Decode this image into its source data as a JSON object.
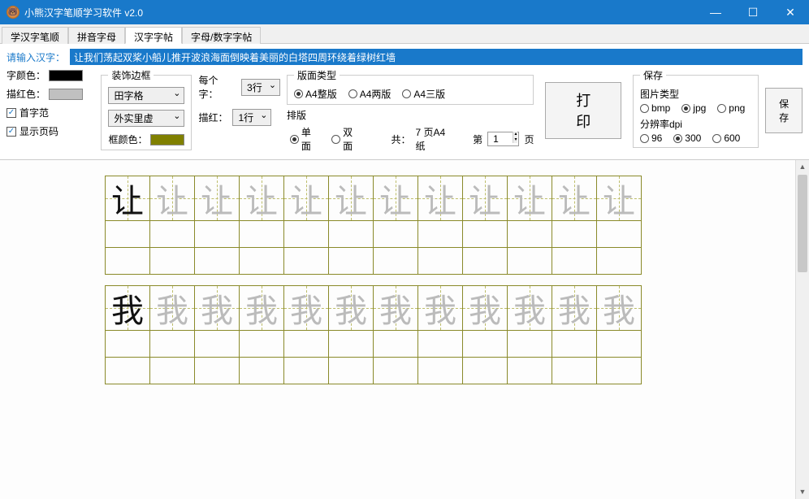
{
  "window": {
    "title": "小熊汉字笔顺学习软件 v2.0"
  },
  "tabs": [
    "学汉字笔顺",
    "拼音字母",
    "汉字字帖",
    "字母/数字字帖"
  ],
  "active_tab": 2,
  "input": {
    "label": "请输入汉字：",
    "value": "让我们荡起双桨小船儿推开波浪海面倒映着美丽的白塔四周环绕着绿树红墙"
  },
  "color": {
    "font_label": "字颜色：",
    "font": "#000000",
    "trace_label": "描红色：",
    "trace": "#c0c0c0"
  },
  "opts": {
    "first_model": "首字范",
    "show_page": "显示页码"
  },
  "border": {
    "legend": "装饰边框",
    "grid_style": "田字格",
    "line_style": "外实里虚",
    "frame_label": "框颜色：",
    "frame_color": "#808000"
  },
  "perchar": {
    "label": "每个字：",
    "rows_val": "3行",
    "trace_label": "描红：",
    "trace_val": "1行"
  },
  "layout": {
    "type_legend": "版面类型",
    "types": [
      "A4整版",
      "A4两版",
      "A4三版"
    ],
    "type_sel": 0,
    "arrange_legend": "排版",
    "arranges": [
      "单面",
      "双面"
    ],
    "arrange_sel": 0,
    "stat_prefix": "共：",
    "stat_val": "7 页A4纸",
    "page_prefix": "第",
    "page_val": "1",
    "page_suffix": "页"
  },
  "print_label": "打印",
  "save": {
    "legend": "保存",
    "imgtype_label": "图片类型",
    "imgtypes": [
      "bmp",
      "jpg",
      "png"
    ],
    "imgtype_sel": 1,
    "dpi_label": "分辨率dpi",
    "dpis": [
      "96",
      "300",
      "600"
    ],
    "dpi_sel": 1,
    "btn": "保存"
  },
  "chart_data": {
    "type": "table",
    "cols": 12,
    "blocks": [
      {
        "char": "让",
        "rows": [
          [
            "solid",
            "ghost",
            "ghost",
            "ghost",
            "ghost",
            "ghost",
            "ghost",
            "ghost",
            "ghost",
            "ghost",
            "ghost",
            "ghost"
          ],
          "empty",
          "empty"
        ]
      },
      {
        "char": "我",
        "rows": [
          [
            "solid",
            "ghost",
            "ghost",
            "ghost",
            "ghost",
            "ghost",
            "ghost",
            "ghost",
            "ghost",
            "ghost",
            "ghost",
            "ghost"
          ],
          "empty",
          "empty"
        ]
      }
    ]
  }
}
